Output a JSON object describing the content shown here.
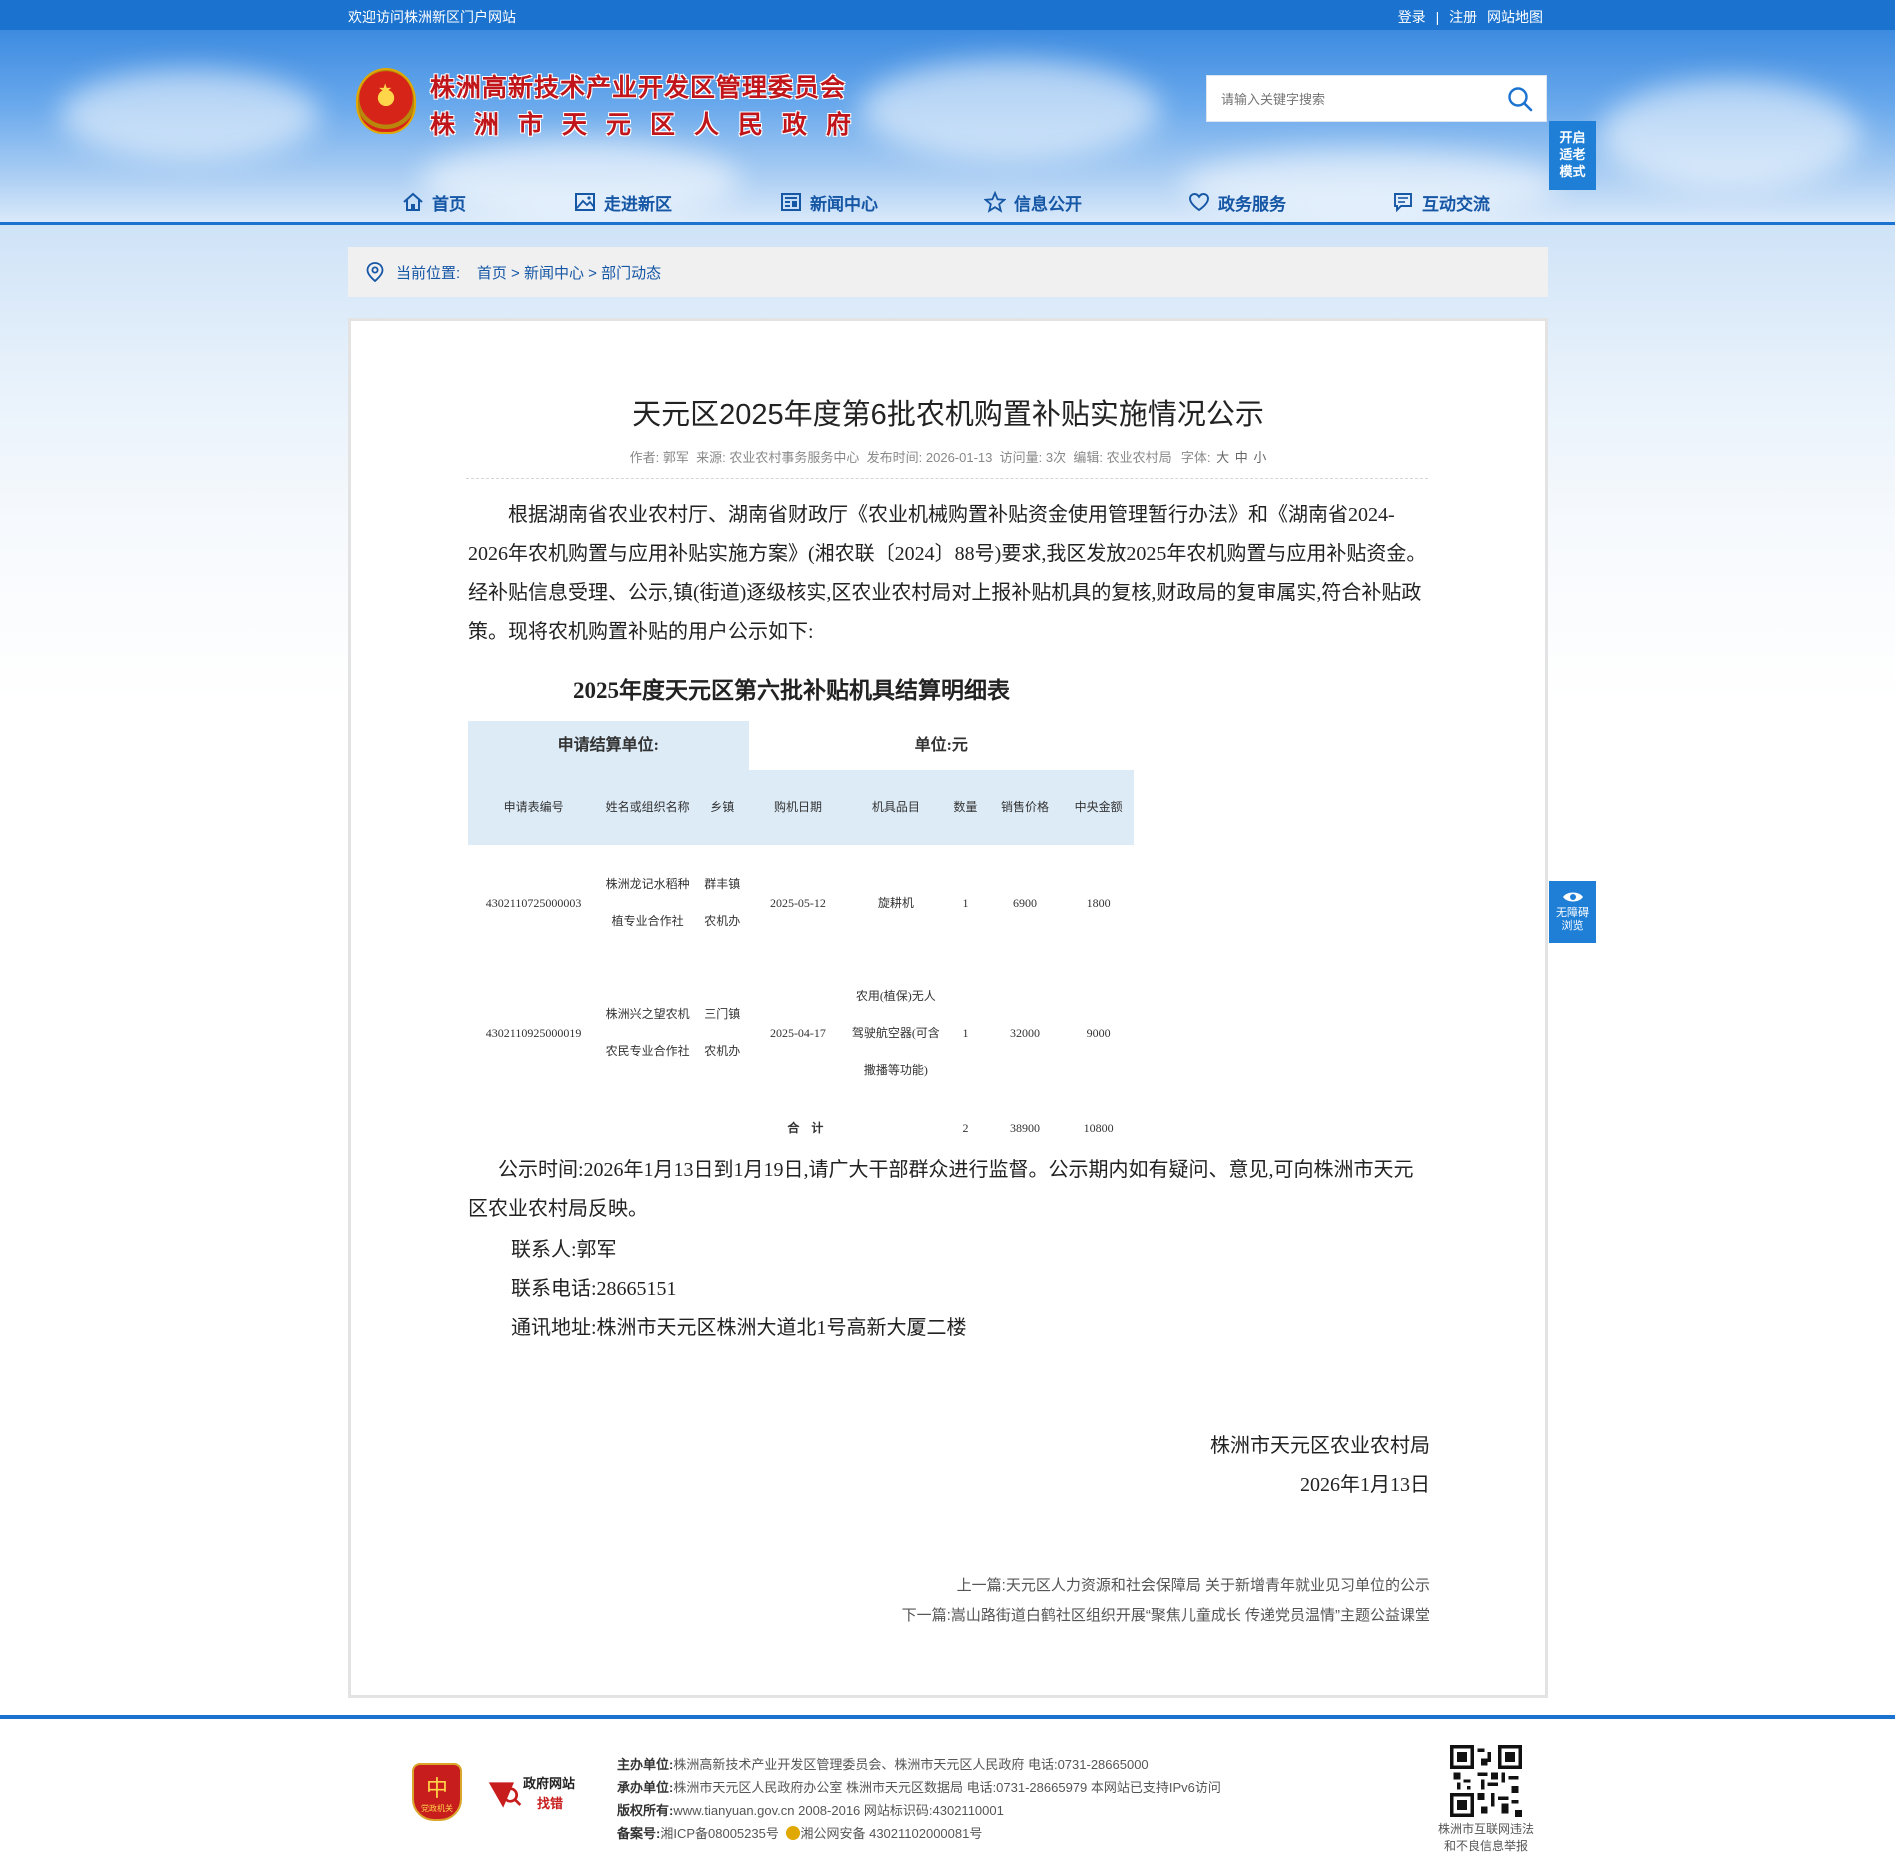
{
  "topbar": {
    "welcome": "欢迎访问株洲新区门户网站",
    "login": "登录",
    "sep": "|",
    "register": "注册",
    "sitemap": "网站地图"
  },
  "header": {
    "title_line1": "株洲高新技术产业开发区管理委员会",
    "title_line2": "株洲市天元区人民政府",
    "search_placeholder": "请输入关键字搜索",
    "elder_mode": [
      "开启",
      "适老",
      "模式"
    ]
  },
  "nav": [
    {
      "label": "首页",
      "icon": "home-icon"
    },
    {
      "label": "走进新区",
      "icon": "picture-icon"
    },
    {
      "label": "新闻中心",
      "icon": "newspaper-icon"
    },
    {
      "label": "信息公开",
      "icon": "star-icon"
    },
    {
      "label": "政务服务",
      "icon": "heart-icon"
    },
    {
      "label": "互动交流",
      "icon": "chat-icon"
    }
  ],
  "breadcrumb": {
    "label": "当前位置:",
    "items": [
      "首页",
      "新闻中心",
      "部门动态"
    ],
    "sep": ">"
  },
  "article": {
    "title": "天元区2025年度第6批农机购置补贴实施情况公示",
    "meta": {
      "author_label": "作者:",
      "author": "郭军",
      "source_label": "来源:",
      "source": "农业农村事务服务中心",
      "date_label": "发布时间:",
      "date": "2026-01-13",
      "views_label": "访问量:",
      "views": "3次",
      "editor_label": "编辑:",
      "editor": "农业农村局",
      "font_label": "字体:",
      "font_sizes": [
        "大",
        "中",
        "小"
      ]
    },
    "paragraph1": "根据湖南省农业农村厅、湖南省财政厅《农业机械购置补贴资金使用管理暂行办法》和《湖南省2024-2026年农机购置与应用补贴实施方案》(湘农联〔2024〕88号)要求,我区发放2025年农机购置与应用补贴资金。经补贴信息受理、公示,镇(街道)逐级核实,区农业农村局对上报补贴机具的复核,财政局的复审属实,符合补贴政策。现将农机购置补贴的用户公示如下:",
    "table_title": "2025年度天元区第六批补贴机具结算明细表",
    "table": {
      "unit_left": "申请结算单位:",
      "unit_right": "单位:元",
      "headers": [
        "申请表编号",
        "姓名或组织名称",
        "乡镇",
        "购机日期",
        "机具品目",
        "数量",
        "销售价格",
        "中央金额"
      ],
      "rows": [
        [
          "4302110725000003",
          "株洲龙记水稻种植专业合作社",
          "群丰镇农机办",
          "2025-05-12",
          "旋耕机",
          "1",
          "6900",
          "1800"
        ],
        [
          "4302110925000019",
          "株洲兴之望农机农民专业合作社",
          "三门镇农机办",
          "2025-04-17",
          "农用(植保)无人驾驶航空器(可含撒播等功能)",
          "1",
          "32000",
          "9000"
        ]
      ],
      "total_label": "合　计",
      "total_qty": "2",
      "total_price": "38900",
      "total_central": "10800"
    },
    "paragraph2": "公示时间:2026年1月13日到1月19日,请广大干部群众进行监督。公示期内如有疑问、意见,可向株洲市天元区农业农村局反映。",
    "contact_person": "联系人:郭军",
    "contact_phone": "联系电话:28665151",
    "contact_address": "通讯地址:株洲市天元区株洲大道北1号高新大厦二楼",
    "sign_org": "株洲市天元区农业农村局",
    "sign_date": "2026年1月13日",
    "prev_label": "上一篇:",
    "prev_title": "天元区人力资源和社会保障局 关于新增青年就业见习单位的公示",
    "next_label": "下一篇:",
    "next_title": "嵩山路街道白鹤社区组织开展“聚焦儿童成长 传递党员温情”主题公益课堂"
  },
  "accessibility": [
    "无障碍",
    "浏览"
  ],
  "footer": {
    "party_badge": "党政机关",
    "find_error_t1": "政府网站",
    "find_error_t2": "找错",
    "host_label": "主办单位:",
    "host": "株洲高新技术产业开发区管理委员会、株洲市天元区人民政府 电话:0731-28665000",
    "undertake_label": "承办单位:",
    "undertake": "株洲市天元区人民政府办公室 株洲市天元区数据局 电话:0731-28665979 本网站已支持IPv6访问",
    "copyright_label": "版权所有:",
    "copyright": "www.tianyuan.gov.cn 2008-2016 网站标识码:4302110001",
    "record_label": "备案号:",
    "icp": "湘ICP备08005235号",
    "police": "湘公网安备 43021102000081号",
    "qr_text1": "株洲市互联网违法",
    "qr_text2": "和不良信息举报"
  }
}
